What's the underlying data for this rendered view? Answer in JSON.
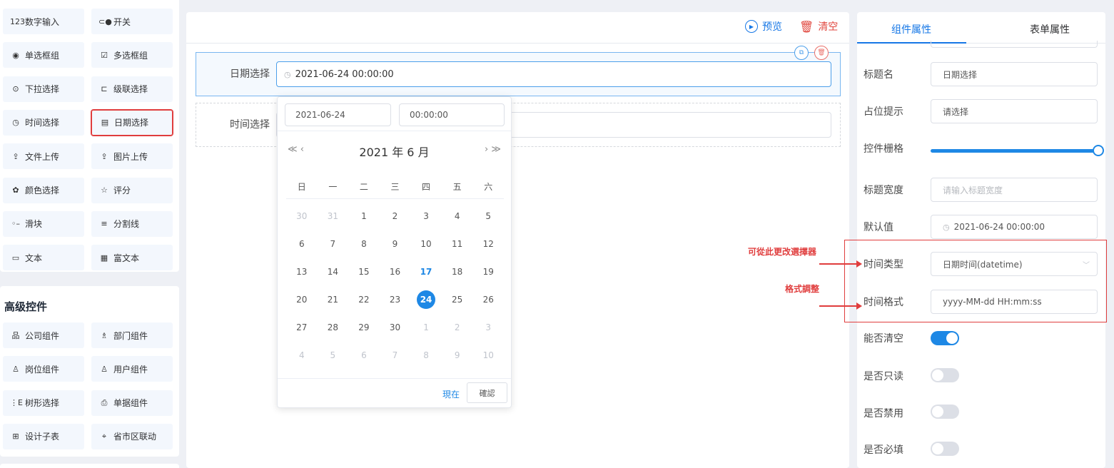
{
  "palette": {
    "basic": [
      {
        "icon": "123",
        "label": "数字输入"
      },
      {
        "icon": "⊂●",
        "label": "开关"
      },
      {
        "icon": "◉",
        "label": "单选框组"
      },
      {
        "icon": "☑",
        "label": "多选框组"
      },
      {
        "icon": "⊙",
        "label": "下拉选择"
      },
      {
        "icon": "⊏",
        "label": "级联选择"
      },
      {
        "icon": "◷",
        "label": "时间选择"
      },
      {
        "icon": "▤",
        "label": "日期选择"
      },
      {
        "icon": "⇪",
        "label": "文件上传"
      },
      {
        "icon": "⇪",
        "label": "图片上传"
      },
      {
        "icon": "✿",
        "label": "颜色选择"
      },
      {
        "icon": "☆",
        "label": "评分"
      },
      {
        "icon": "◦–",
        "label": "滑块"
      },
      {
        "icon": "≡",
        "label": "分割线"
      },
      {
        "icon": "▭",
        "label": "文本"
      },
      {
        "icon": "▦",
        "label": "富文本"
      }
    ],
    "advanced_title": "高级控件",
    "advanced": [
      {
        "icon": "品",
        "label": "公司组件"
      },
      {
        "icon": "♗",
        "label": "部门组件"
      },
      {
        "icon": "♙",
        "label": "岗位组件"
      },
      {
        "icon": "♙",
        "label": "用户组件"
      },
      {
        "icon": "⋮E",
        "label": "树形选择"
      },
      {
        "icon": "⎙",
        "label": "单据组件"
      },
      {
        "icon": "⊞",
        "label": "设计子表"
      },
      {
        "icon": "⌖",
        "label": "省市区联动"
      }
    ]
  },
  "toolbar": {
    "preview": "预览",
    "clear": "清空"
  },
  "canvas": {
    "field1": {
      "label": "日期选择",
      "value": "2021-06-24 00:00:00"
    },
    "field2": {
      "label": "时间选择"
    }
  },
  "picker": {
    "date_input": "2021-06-24",
    "time_input": "00:00:00",
    "prev": "≪ ‹",
    "next": "› ≫",
    "title": "2021 年  6 月",
    "weekdays": [
      "日",
      "一",
      "二",
      "三",
      "四",
      "五",
      "六"
    ],
    "days": [
      [
        "30",
        "other"
      ],
      [
        "31",
        "other"
      ],
      [
        "1",
        ""
      ],
      [
        "2",
        ""
      ],
      [
        "3",
        ""
      ],
      [
        "4",
        ""
      ],
      [
        "5",
        ""
      ],
      [
        "6",
        ""
      ],
      [
        "7",
        ""
      ],
      [
        "8",
        ""
      ],
      [
        "9",
        ""
      ],
      [
        "10",
        ""
      ],
      [
        "11",
        ""
      ],
      [
        "12",
        ""
      ],
      [
        "13",
        ""
      ],
      [
        "14",
        ""
      ],
      [
        "15",
        ""
      ],
      [
        "16",
        ""
      ],
      [
        "17",
        "today"
      ],
      [
        "18",
        ""
      ],
      [
        "19",
        ""
      ],
      [
        "20",
        ""
      ],
      [
        "21",
        ""
      ],
      [
        "22",
        ""
      ],
      [
        "23",
        ""
      ],
      [
        "24",
        "sel"
      ],
      [
        "25",
        ""
      ],
      [
        "26",
        ""
      ],
      [
        "27",
        ""
      ],
      [
        "28",
        ""
      ],
      [
        "29",
        ""
      ],
      [
        "30",
        ""
      ],
      [
        "1",
        "other"
      ],
      [
        "2",
        "other"
      ],
      [
        "3",
        "other"
      ],
      [
        "4",
        "other"
      ],
      [
        "5",
        "other"
      ],
      [
        "6",
        "other"
      ],
      [
        "7",
        "other"
      ],
      [
        "8",
        "other"
      ],
      [
        "9",
        "other"
      ],
      [
        "10",
        "other"
      ]
    ],
    "now": "現在",
    "ok": "確認"
  },
  "props": {
    "tab_active": "组件属性",
    "tab_other": "表单属性",
    "title_label": "标题名",
    "title_value": "日期选择",
    "placeholder_label": "占位提示",
    "placeholder_value": "请选择",
    "grid_label": "控件栅格",
    "grid_value": 24,
    "label_width_label": "标题宽度",
    "label_width_placeholder": "请输入标题宽度",
    "default_label": "默认值",
    "default_value": "2021-06-24 00:00:00",
    "type_label": "时间类型",
    "type_value": "日期时间(datetime)",
    "format_label": "时间格式",
    "format_value": "yyyy-MM-dd HH:mm:ss",
    "clearable_label": "能否清空",
    "clearable": true,
    "readonly_label": "是否只读",
    "readonly": false,
    "disabled_label": "是否禁用",
    "disabled": false,
    "required_label": "是否必填",
    "required": false
  },
  "annotations": {
    "picker_note": "可從此更改選擇器",
    "format_note": "格式調整",
    "color": "#e03d3d"
  }
}
